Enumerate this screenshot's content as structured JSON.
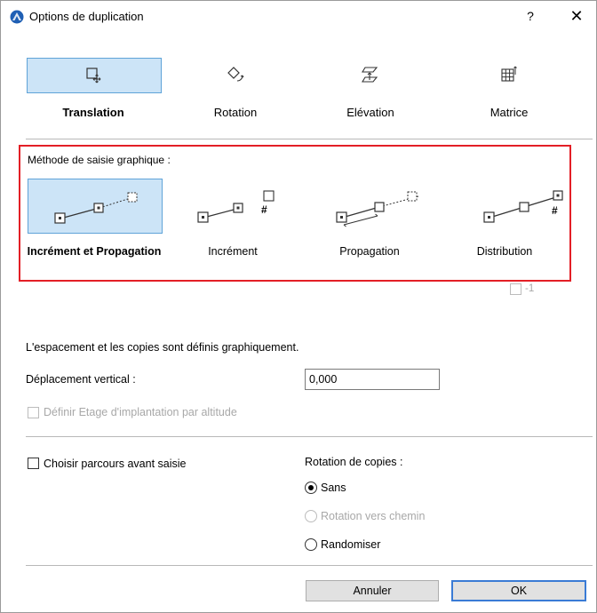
{
  "window": {
    "title": "Options de duplication",
    "help_label": "?",
    "close_label": "✕",
    "app_icon": "archicad-icon"
  },
  "tabs": [
    {
      "label": "Translation",
      "icon": "translation-icon",
      "selected": true
    },
    {
      "label": "Rotation",
      "icon": "rotation-icon",
      "selected": false
    },
    {
      "label": "Elévation",
      "icon": "elevation-icon",
      "selected": false
    },
    {
      "label": "Matrice",
      "icon": "matrix-icon",
      "selected": false
    }
  ],
  "method": {
    "heading": "Méthode de saisie graphique :",
    "options": [
      {
        "label": "Incrément et Propagation",
        "selected": true
      },
      {
        "label": "Incrément",
        "selected": false
      },
      {
        "label": "Propagation",
        "selected": false
      },
      {
        "label": "Distribution",
        "selected": false
      }
    ],
    "increment_hash": "#",
    "distribution_hash": "#",
    "minus_one_label": "-1"
  },
  "info_text": "L'espacement et les copies sont définis graphiquement.",
  "vertical_offset": {
    "label": "Déplacement vertical :",
    "value": "0,000"
  },
  "define_story": {
    "label": "Définir Etage d'implantation par altitude",
    "checked": false,
    "disabled": true
  },
  "choose_path": {
    "label": "Choisir parcours avant saisie",
    "checked": false
  },
  "rotation": {
    "heading": "Rotation de copies :",
    "options": [
      {
        "label": "Sans",
        "selected": true,
        "disabled": false
      },
      {
        "label": "Rotation vers chemin",
        "selected": false,
        "disabled": true
      },
      {
        "label": "Randomiser",
        "selected": false,
        "disabled": false
      }
    ]
  },
  "buttons": {
    "cancel": "Annuler",
    "ok": "OK"
  },
  "colors": {
    "selection_bg": "#cce4f7",
    "selection_border": "#5fa3d8",
    "highlight_box": "#e31f26",
    "ok_border": "#3a7bd5"
  }
}
